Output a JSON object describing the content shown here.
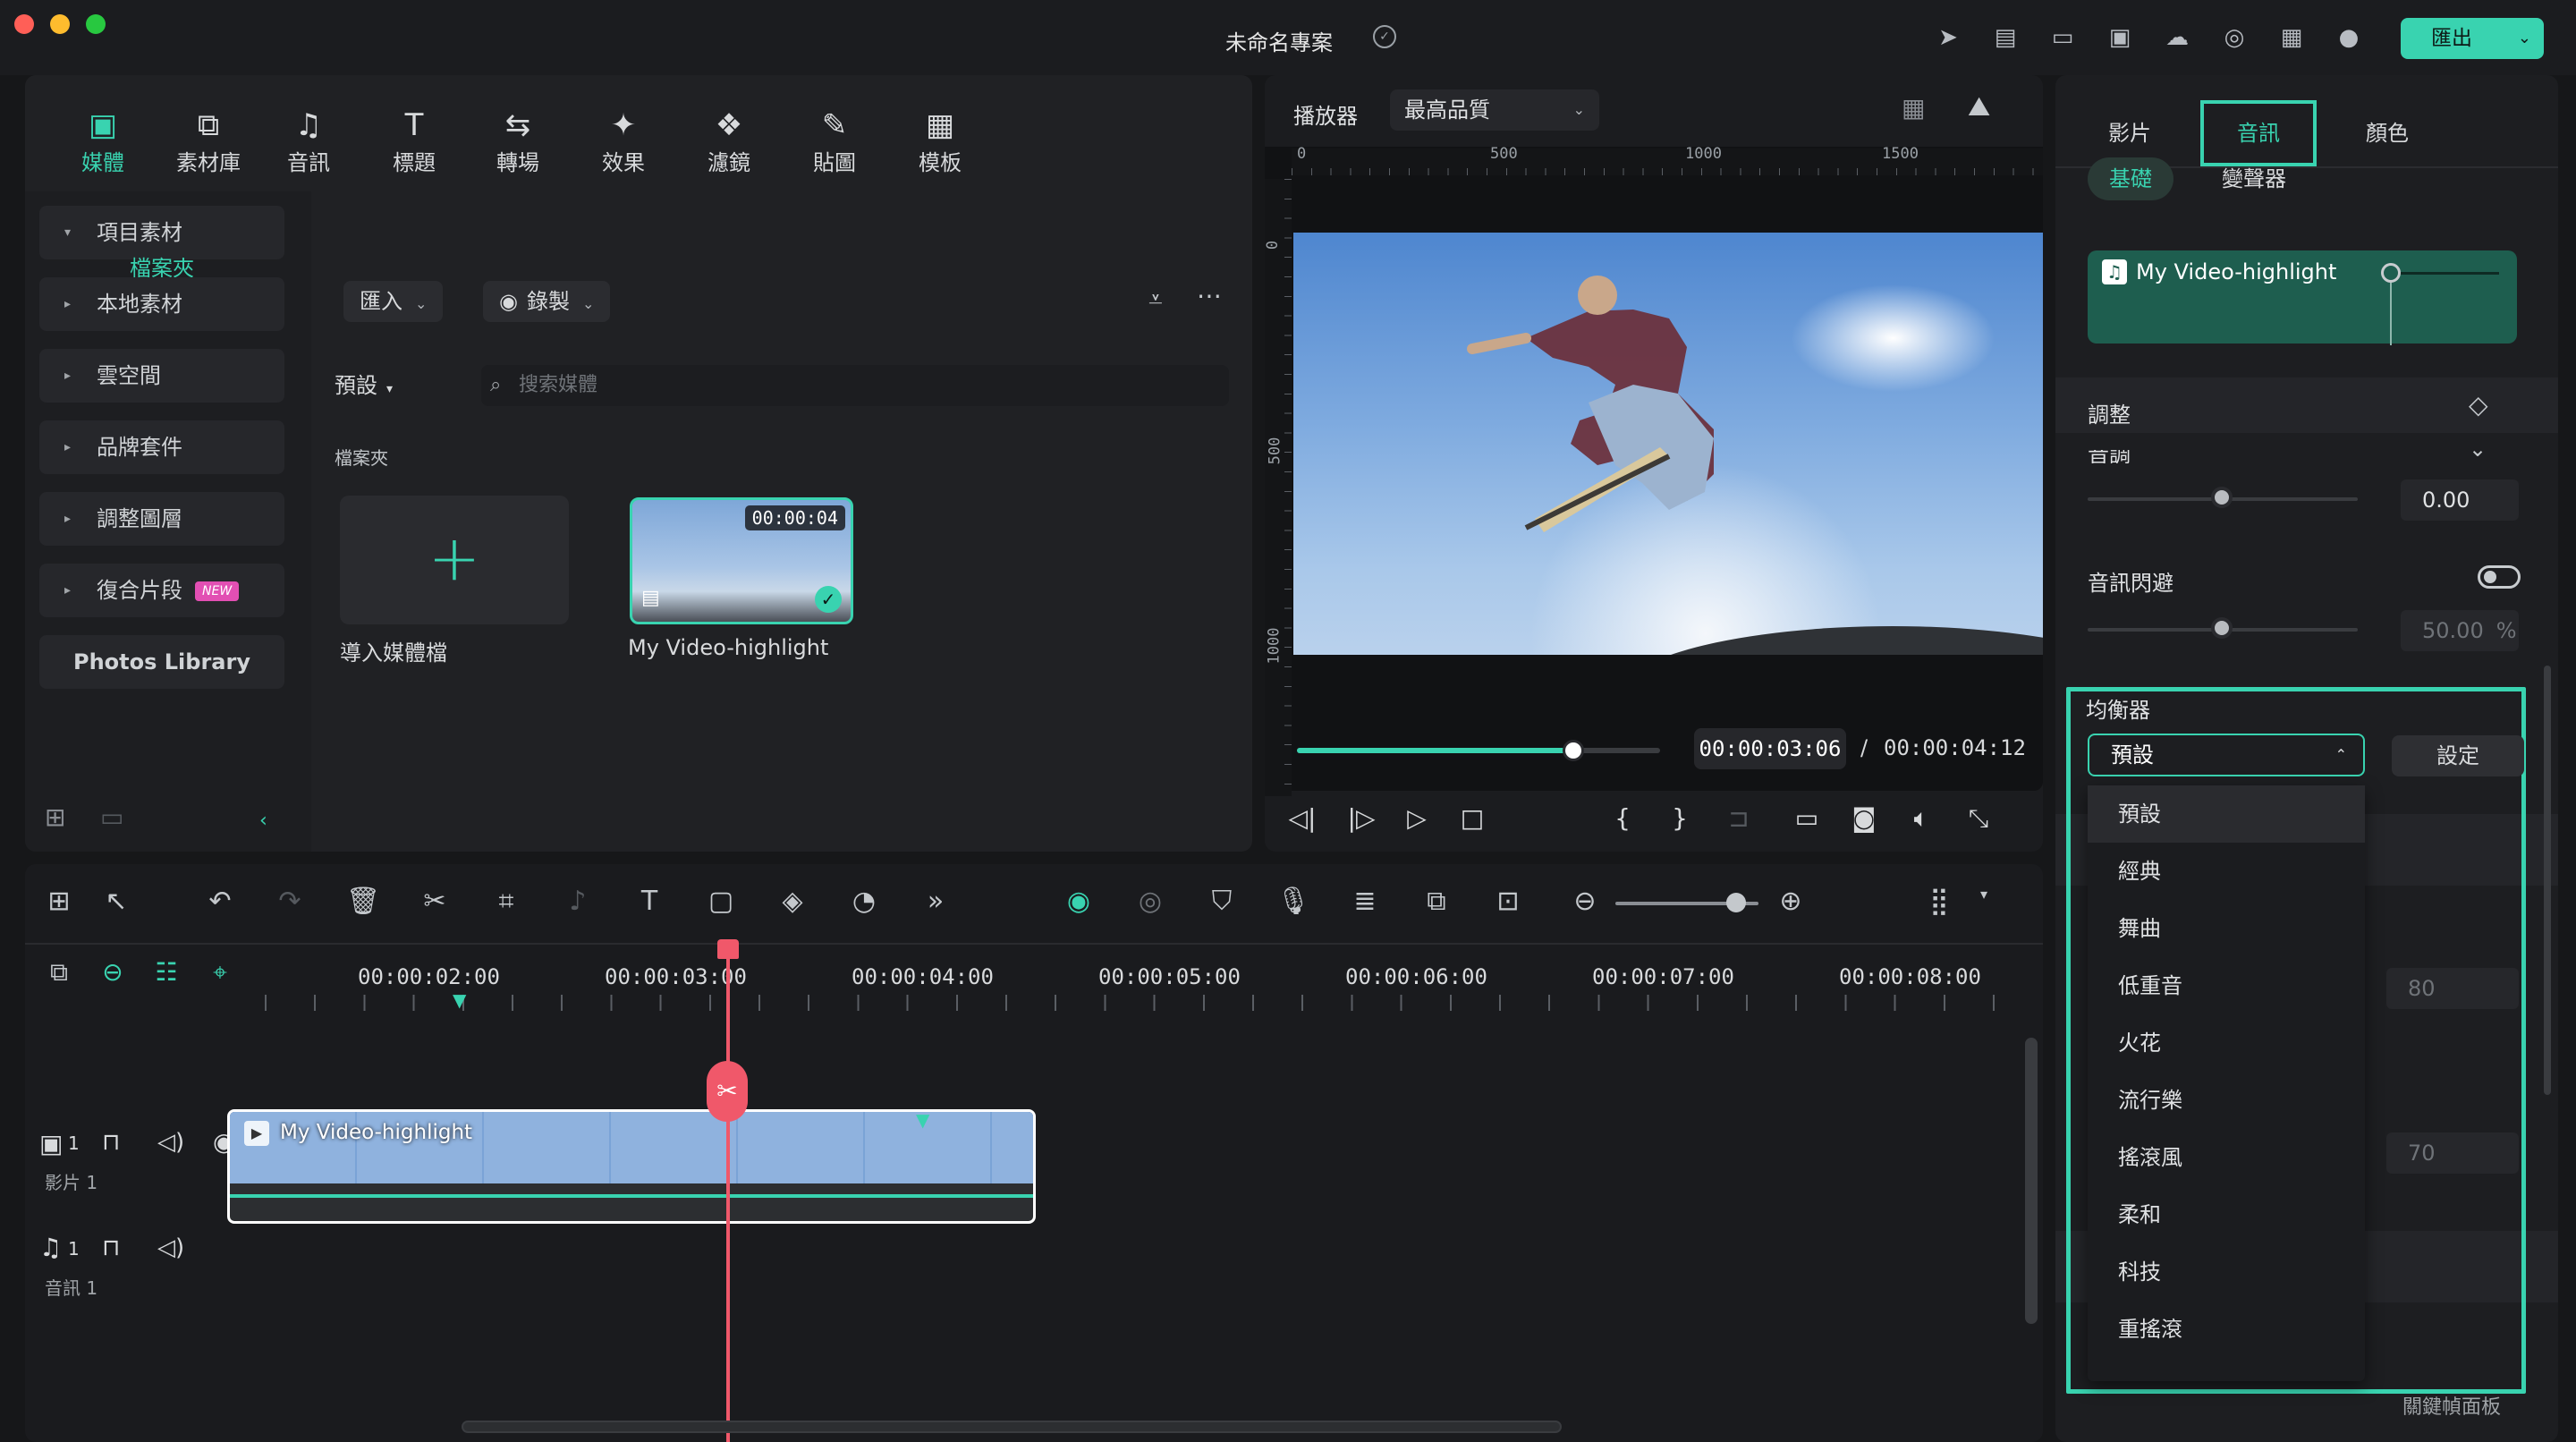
{
  "window": {
    "title": "未命名專案",
    "export_label": "匯出",
    "traffic_colors": [
      "#ff5f57",
      "#febc2e",
      "#28c840"
    ]
  },
  "media": {
    "tabs": [
      {
        "label": "媒體",
        "icon": "media-icon",
        "active": true
      },
      {
        "label": "素材庫",
        "icon": "stock-library-icon"
      },
      {
        "label": "音訊",
        "icon": "music-note-icon"
      },
      {
        "label": "標題",
        "icon": "text-icon"
      },
      {
        "label": "轉場",
        "icon": "transition-icon"
      },
      {
        "label": "效果",
        "icon": "effects-icon"
      },
      {
        "label": "濾鏡",
        "icon": "filters-icon"
      },
      {
        "label": "貼圖",
        "icon": "sticker-icon"
      },
      {
        "label": "模板",
        "icon": "template-icon"
      }
    ],
    "sidebar": {
      "project_media": "項目素材",
      "folder": "檔案夾",
      "items": [
        "本地素材",
        "雲空間",
        "品牌套件",
        "調整圖層",
        "復合片段"
      ],
      "new_badge": "NEW",
      "photos_library": "Photos Library"
    },
    "import_btn": "匯入",
    "record_btn": "錄製",
    "preset_dd": "預設",
    "search_placeholder": "搜索媒體",
    "folder_label": "檔案夾",
    "import_card_label": "導入媒體檔",
    "clip_card": {
      "name": "My Video-highlight",
      "duration": "00:00:04"
    }
  },
  "player": {
    "label": "播放器",
    "quality": "最高品質",
    "ruler_labels": [
      "0",
      "500",
      "1000",
      "1500"
    ],
    "ruler_v_labels": [
      "0",
      "500",
      "1000"
    ],
    "current_time": "00:00:03:06",
    "separator": "/",
    "total_time": "00:00:04:12",
    "progress": 0.76
  },
  "properties": {
    "tabs": [
      "影片",
      "音訊",
      "顏色"
    ],
    "active_tab": "音訊",
    "subtabs": [
      "基礎",
      "變聲器"
    ],
    "clip_name": "My Video-highlight",
    "adjust_label": "調整",
    "pitch_label": "音調",
    "pitch_value": "0.00",
    "ducking_label": "音訊閃避",
    "ducking_value": "50.00",
    "ducking_unit": "%",
    "eq_label": "均衡器",
    "eq_selected": "預設",
    "set_button": "設定",
    "eq_options": [
      "預設",
      "經典",
      "舞曲",
      "低重音",
      "火花",
      "流行樂",
      "搖滾風",
      "柔和",
      "科技",
      "重搖滾"
    ],
    "hidden_value_1": "80",
    "hidden_value_2": "70",
    "keyframe_panel": "關鍵幀面板"
  },
  "timeline": {
    "tick_labels": [
      "00:00:02:00",
      "00:00:03:00",
      "00:00:04:00",
      "00:00:05:00",
      "00:00:06:00",
      "00:00:07:00",
      "00:00:08:00"
    ],
    "video_track": {
      "index": "1",
      "label": "影片 1"
    },
    "audio_track": {
      "index": "1",
      "label": "音訊 1"
    },
    "clip_title": "My Video-highlight"
  },
  "colors": {
    "accent": "#39d3b0",
    "playhead": "#f0586a"
  }
}
